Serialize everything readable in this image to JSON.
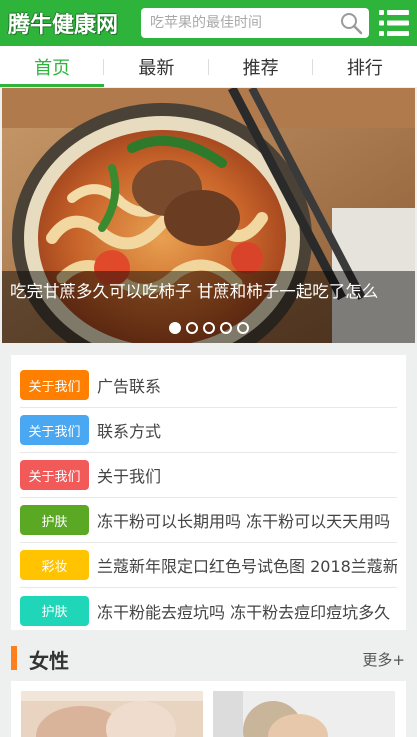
{
  "header": {
    "logo_text": "腾牛健康网",
    "search_placeholder": "吃苹果的最佳时间"
  },
  "nav": {
    "tabs": [
      {
        "label": "首页",
        "active": true
      },
      {
        "label": "最新",
        "active": false
      },
      {
        "label": "推荐",
        "active": false
      },
      {
        "label": "排行",
        "active": false
      }
    ]
  },
  "banner": {
    "caption": "吃完甘蔗多久可以吃柿子 甘蔗和柿子一起吃了怎么",
    "dots": 5,
    "active_dot": 1
  },
  "list": {
    "items": [
      {
        "tag": "关于我们",
        "tag_color": "#ff7f00",
        "text": "广告联系"
      },
      {
        "tag": "关于我们",
        "tag_color": "#4aa8f2",
        "text": "联系方式"
      },
      {
        "tag": "关于我们",
        "tag_color": "#f25a5a",
        "text": "关于我们"
      },
      {
        "tag": "护肤",
        "tag_color": "#5aa824",
        "text": "冻干粉可以长期用吗 冻干粉可以天天用吗"
      },
      {
        "tag": "彩妆",
        "tag_color": "#ffc300",
        "text": "兰蔻新年限定口红色号试色图 2018兰蔻新"
      },
      {
        "tag": "护肤",
        "tag_color": "#1fd6b8",
        "text": "冻干粉能去痘坑吗 冻干粉去痘印痘坑多久"
      }
    ]
  },
  "section": {
    "title": "女性",
    "more": "更多+"
  },
  "colors": {
    "brand_green": "#2eb33b",
    "section_accent": "#ff7f1f"
  },
  "icons": {
    "search": "search-icon",
    "menu": "menu-list-icon"
  }
}
